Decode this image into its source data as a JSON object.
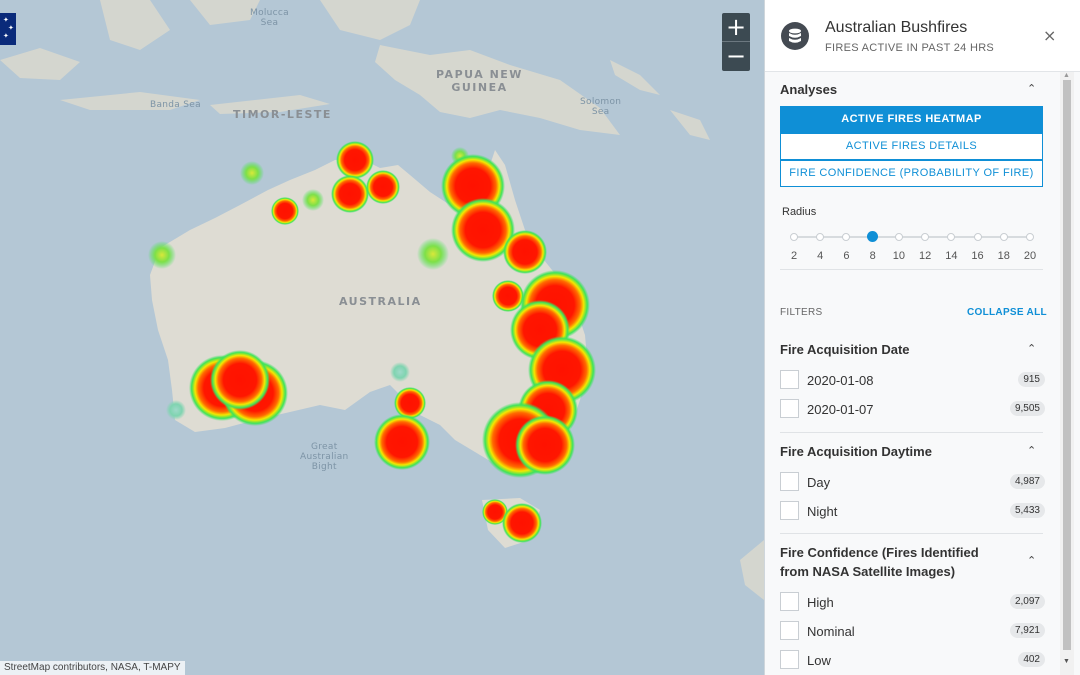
{
  "map": {
    "labels": {
      "papua_new_guinea": "PAPUA NEW\nGUINEA",
      "timor_leste": "TIMOR-LESTE",
      "australia": "AUSTRALIA",
      "banda_sea": "Banda Sea",
      "solomon_sea": "Solomon\nSea",
      "molucca_sea": "Molucca\nSea",
      "great_australian_bight": "Great\nAustralian\nBight"
    },
    "zoom_in": "+",
    "zoom_out": "−",
    "attribution": "StreetMap contributors, NASA, T-MAPY",
    "colors": {
      "ocean": "#b4c7d5",
      "land": "#dcdcd3",
      "heat_core": "#ff1a00",
      "heat_mid": "#ffee00",
      "heat_outer": "#22e05a"
    }
  },
  "panel": {
    "title": "Australian Bushfires",
    "subtitle": "FIRES ACTIVE IN PAST 24 HRS",
    "icon": "database-icon",
    "close": "×",
    "analyses": {
      "heading": "Analyses",
      "buttons": [
        {
          "label": "ACTIVE FIRES HEATMAP",
          "active": true
        },
        {
          "label": "ACTIVE FIRES DETAILS",
          "active": false
        },
        {
          "label": "FIRE CONFIDENCE (PROBABILITY OF FIRE)",
          "active": false
        }
      ],
      "radius_label": "Radius",
      "radius_ticks": [
        "2",
        "4",
        "6",
        "8",
        "10",
        "12",
        "14",
        "16",
        "18",
        "20"
      ],
      "radius_value": 8
    },
    "filters_label": "FILTERS",
    "collapse_all": "COLLAPSE ALL",
    "groups": [
      {
        "title": "Fire Acquisition Date",
        "items": [
          {
            "label": "2020-01-08",
            "count": "915"
          },
          {
            "label": "2020-01-07",
            "count": "9,505"
          }
        ]
      },
      {
        "title": "Fire Acquisition Daytime",
        "items": [
          {
            "label": "Day",
            "count": "4,987"
          },
          {
            "label": "Night",
            "count": "5,433"
          }
        ]
      },
      {
        "title": "Fire Confidence (Fires Identified",
        "title_line2": "from NASA Satellite Images)",
        "items": [
          {
            "label": "High",
            "count": "2,097"
          },
          {
            "label": "Nominal",
            "count": "7,921"
          },
          {
            "label": "Low",
            "count": "402"
          }
        ]
      }
    ],
    "accent_color": "#0f8fd6"
  }
}
